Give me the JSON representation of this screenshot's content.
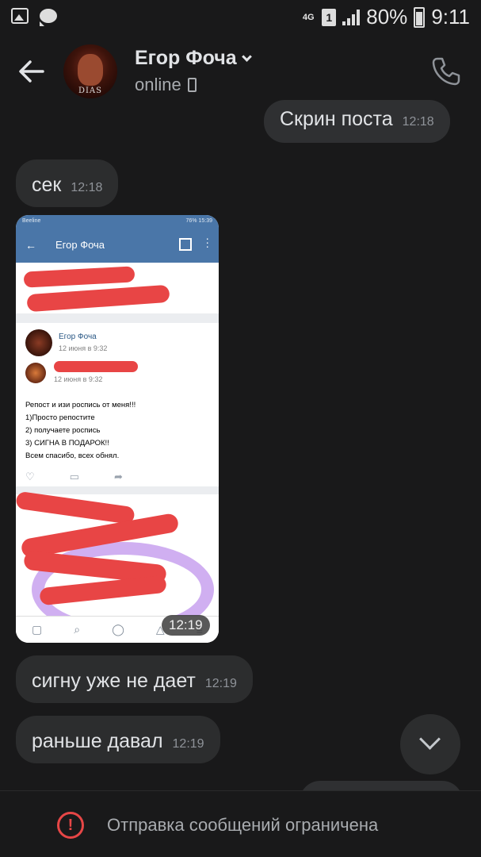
{
  "status_bar": {
    "network": "4G",
    "sim": "1",
    "battery": "80%",
    "time": "9:11"
  },
  "header": {
    "name": "Егор Фоча",
    "status": "online",
    "avatar_text": "DIAS"
  },
  "messages": [
    {
      "direction": "out",
      "text": "Скрин поста",
      "time": "12:18"
    },
    {
      "direction": "in",
      "text": "сек",
      "time": "12:18"
    },
    {
      "direction": "in",
      "type": "image",
      "time": "12:19"
    },
    {
      "direction": "in",
      "text": "сигну уже не дает",
      "time": "12:19"
    },
    {
      "direction": "in",
      "text": "раньше давал",
      "time": "12:19"
    }
  ],
  "screenshot": {
    "status_left": "Beeline",
    "status_right": "76% 15:39",
    "title": "Егор Фоча",
    "post_author": "Егор Фоча",
    "post_date": "12 июня в 9:32",
    "repost_date": "12 июня в 9:32",
    "post_lines": [
      "Репост и изи роспись от меня!!!",
      "1)Просто репостите",
      "2) получаете роспись",
      "3) СИГНА В ПОДАРОК!!",
      "Всем спасибо, всех обнял."
    ]
  },
  "footer": {
    "notice": "Отправка сообщений ограничена"
  },
  "colors": {
    "background": "#19191a",
    "bubble": "#2c2d2e",
    "warning": "#e64646",
    "vk_blue": "#4a76a8"
  }
}
